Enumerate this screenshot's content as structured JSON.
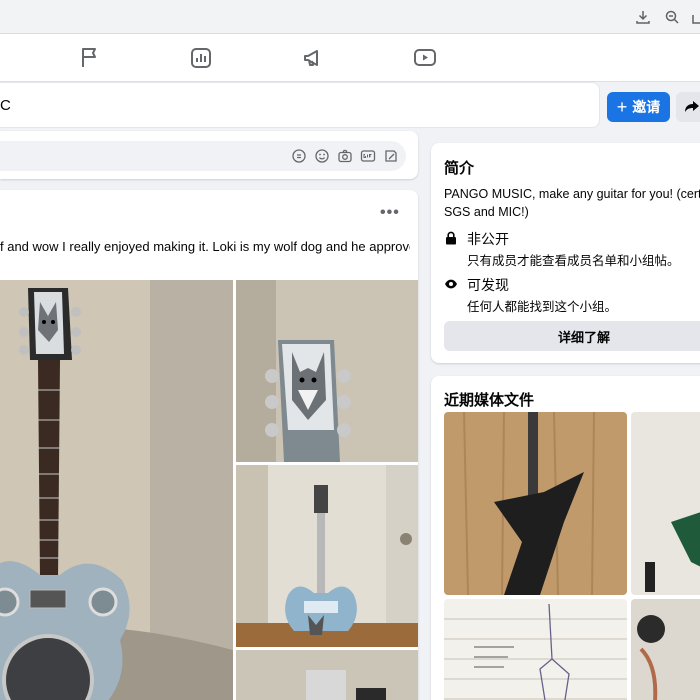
{
  "group": {
    "name_fragment": "C",
    "invite_label": "邀请"
  },
  "post": {
    "more_label": "•••",
    "text": "f and wow I really enjoyed making it. Loki is my wolf dog and he approves"
  },
  "about": {
    "title": "简介",
    "description_line1": "PANGO MUSIC, make any guitar for you! (certifie",
    "description_line2": "SGS and MIC!)",
    "privacy_title": "非公开",
    "privacy_desc": "只有成员才能查看成员名单和小组帖。",
    "visibility_title": "可发现",
    "visibility_desc": "任何人都能找到这个小组。",
    "learn_more_label": "详细了解"
  },
  "media": {
    "title": "近期媒体文件"
  },
  "colors": {
    "brand_blue": "#1b74e4",
    "page_bg": "#f0f2f5",
    "button_gray": "#e4e6eb"
  },
  "icons": {
    "chrome": [
      "download-icon",
      "zoom-out-icon",
      "share-icon"
    ],
    "nav": [
      "flag-icon",
      "chart-icon",
      "megaphone-icon",
      "video-icon"
    ],
    "composer": [
      "sticker-icon",
      "emoji-icon",
      "camera-icon",
      "gif-icon",
      "draft-icon"
    ],
    "privacy": [
      "lock-icon",
      "eye-icon"
    ]
  }
}
